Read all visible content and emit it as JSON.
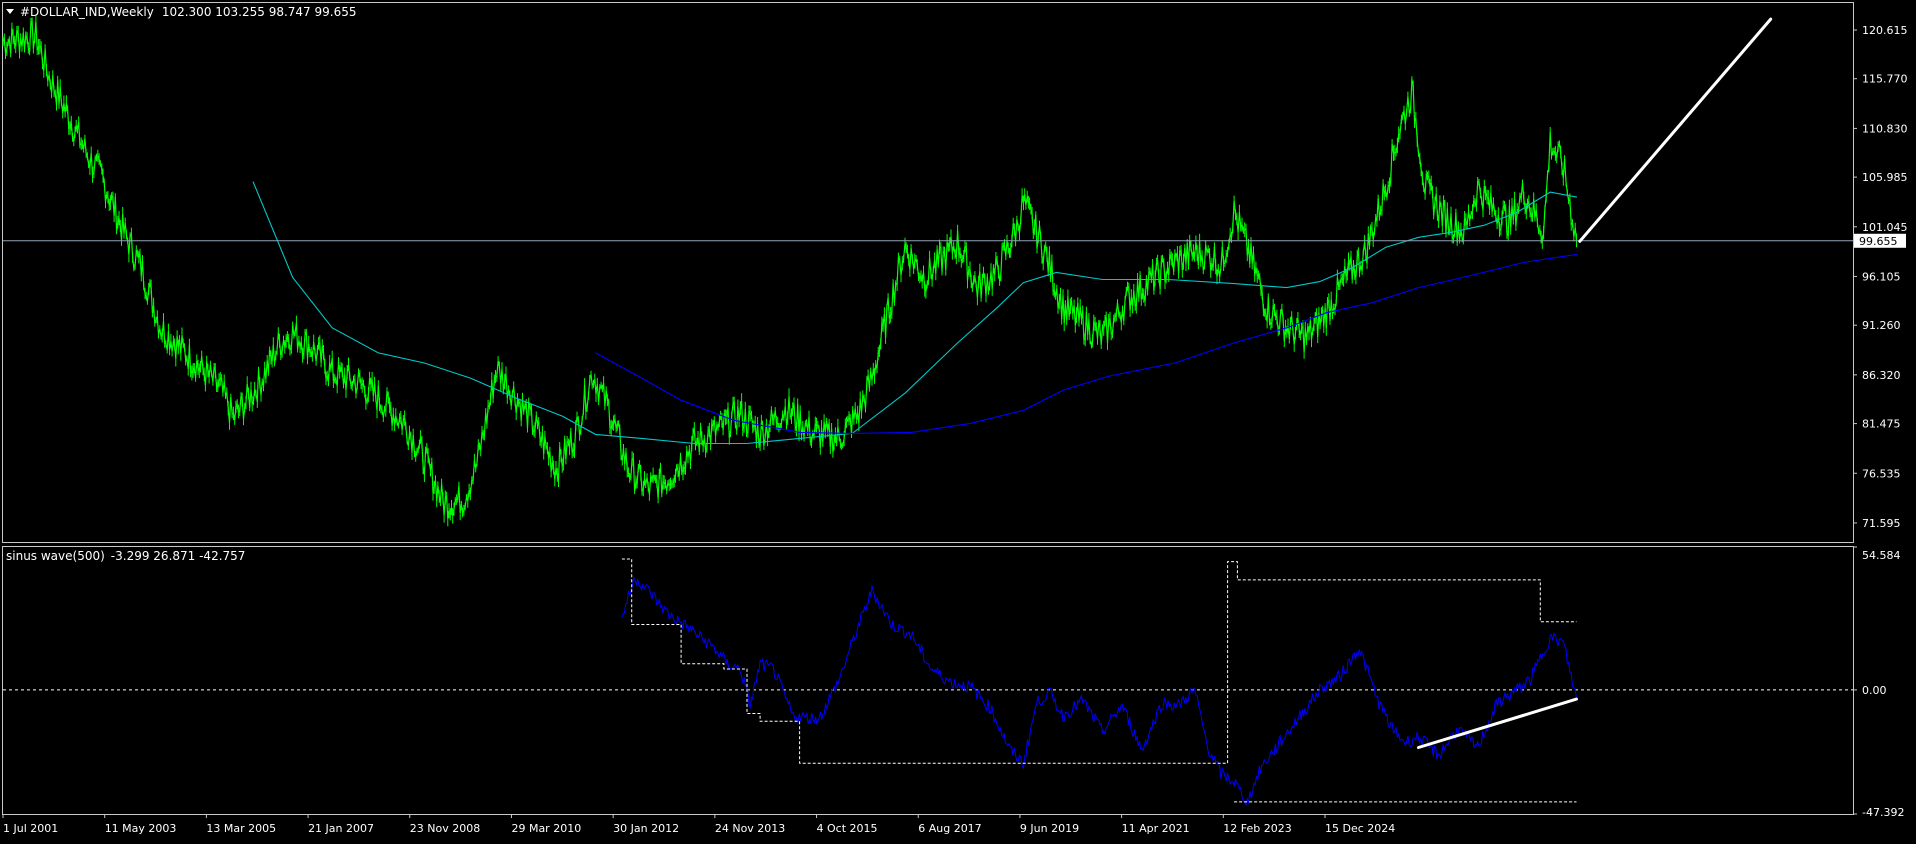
{
  "main_panel": {
    "header": {
      "symbol": "#DOLLAR_IND,Weekly",
      "ohlc": "102.300 103.255 98.747 99.655"
    },
    "y_ticks": [
      "120.615",
      "115.770",
      "110.830",
      "105.985",
      "101.045",
      "96.105",
      "91.260",
      "86.320",
      "81.475",
      "76.535",
      "71.595"
    ],
    "current_price_label": "99.655"
  },
  "sub_panel": {
    "header": {
      "indicator": "sinus wave(500)",
      "values": "-3.299 26.871 -42.757"
    },
    "y_ticks": [
      "54.584",
      "0.00",
      "-47.392"
    ]
  },
  "x_ticks": [
    "1 Jul 2001",
    "11 May 2003",
    "13 Mar 2005",
    "21 Jan 2007",
    "23 Nov 2008",
    "29 Mar 2010",
    "30 Jan 2012",
    "24 Nov 2013",
    "4 Oct 2015",
    "6 Aug 2017",
    "9 Jun 2019",
    "11 Apr 2021",
    "12 Feb 2023",
    "15 Dec 2024"
  ],
  "colors": {
    "background": "#000000",
    "frame": "#c8c8c8",
    "text": "#ffffff",
    "price_line": "#00ff00",
    "ma_fast": "#00c8c8",
    "ma_slow": "#0000ff",
    "hline": "#8fa3b8",
    "indicator_line": "#0000ff",
    "indicator_band": "#ffffff",
    "trendline": "#ffffff"
  },
  "chart_data": [
    {
      "type": "line",
      "title": "#DOLLAR_IND,Weekly",
      "ylim": [
        69.7,
        123.3
      ],
      "xlim": [
        2001.5,
        2029.6
      ],
      "series": [
        {
          "role": "price",
          "x": [
            2001.5,
            2002.0,
            2002.2,
            2002.5,
            2002.8,
            2003.0,
            2003.3,
            2003.6,
            2003.9,
            2004.2,
            2004.5,
            2004.8,
            2005.0,
            2005.4,
            2005.7,
            2005.9,
            2006.2,
            2006.5,
            2006.9,
            2007.2,
            2007.6,
            2007.9,
            2008.2,
            2008.5,
            2008.7,
            2009.0,
            2009.2,
            2009.6,
            2009.9,
            2010.2,
            2010.45,
            2010.7,
            2011.0,
            2011.3,
            2011.6,
            2012.0,
            2012.4,
            2012.7,
            2013.0,
            2013.4,
            2013.8,
            2014.2,
            2014.5,
            2014.7,
            2015.0,
            2015.2,
            2015.5,
            2015.8,
            2016.0,
            2016.3,
            2016.6,
            2016.9,
            2017.0,
            2017.3,
            2017.6,
            2017.9,
            2018.2,
            2018.6,
            2019.0,
            2019.3,
            2019.6,
            2019.9,
            2020.0,
            2020.2,
            2020.4,
            2020.7,
            2021.0,
            2021.3,
            2021.6,
            2021.9,
            2022.2,
            2022.5,
            2022.7,
            2022.9,
            2023.1,
            2023.4,
            2023.7,
            2023.9,
            2024.1,
            2024.4,
            2024.6,
            2024.9,
            2025.0,
            2025.2,
            2025.4
          ],
          "values": [
            119.5,
            120.0,
            116.0,
            112.0,
            108.0,
            106.0,
            101.0,
            97.0,
            91.0,
            89.0,
            87.0,
            85.0,
            82.0,
            85.5,
            89.5,
            90.5,
            89.0,
            86.5,
            85.5,
            84.0,
            81.5,
            78.0,
            73.5,
            74.0,
            77.5,
            87.0,
            85.0,
            81.0,
            77.0,
            80.5,
            86.5,
            83.0,
            77.0,
            75.0,
            76.0,
            79.5,
            81.0,
            82.5,
            80.5,
            83.0,
            80.5,
            80.0,
            82.5,
            86.0,
            94.0,
            99.0,
            96.0,
            98.0,
            99.5,
            95.0,
            96.5,
            101.0,
            103.5,
            99.0,
            93.0,
            91.5,
            90.0,
            94.0,
            96.0,
            97.5,
            98.5,
            98.0,
            97.0,
            102.5,
            99.0,
            93.0,
            91.0,
            90.0,
            92.5,
            96.0,
            98.5,
            105.0,
            110.5,
            114.5,
            105.0,
            102.0,
            100.5,
            105.0,
            103.0,
            101.5,
            104.5,
            100.5,
            109.5,
            107.0,
            99.7
          ]
        },
        {
          "role": "ma-fast",
          "x": [
            2005.3,
            2005.9,
            2006.5,
            2007.2,
            2007.9,
            2008.6,
            2009.3,
            2010.0,
            2010.5,
            2011.2,
            2012.0,
            2012.8,
            2013.6,
            2014.4,
            2015.2,
            2016.0,
            2016.6,
            2017.0,
            2017.5,
            2018.2,
            2019.2,
            2020.2,
            2021.0,
            2021.5,
            2022.0,
            2022.5,
            2023.0,
            2023.5,
            2024.0,
            2024.5,
            2025.0,
            2025.4
          ],
          "values": [
            105.5,
            96.0,
            91.0,
            88.5,
            87.5,
            86.0,
            84.0,
            82.2,
            80.4,
            80.0,
            79.5,
            79.5,
            80.0,
            80.5,
            84.5,
            89.5,
            93.0,
            95.5,
            96.5,
            95.8,
            95.8,
            95.4,
            95.0,
            95.6,
            97.0,
            99.0,
            100.0,
            100.5,
            101.2,
            102.5,
            104.5,
            104.0
          ]
        },
        {
          "role": "ma-slow",
          "x": [
            2010.5,
            2011.2,
            2011.8,
            2012.6,
            2013.6,
            2014.4,
            2015.3,
            2016.2,
            2017.0,
            2017.6,
            2018.3,
            2019.3,
            2020.2,
            2021.0,
            2021.6,
            2022.3,
            2023.0,
            2023.8,
            2024.6,
            2025.4
          ],
          "values": [
            88.5,
            86.0,
            83.8,
            81.8,
            80.6,
            80.5,
            80.6,
            81.5,
            82.8,
            84.8,
            86.2,
            87.5,
            89.5,
            91.0,
            92.5,
            93.5,
            95.0,
            96.2,
            97.5,
            98.3
          ]
        },
        {
          "role": "current-price",
          "x": [
            2001.5,
            2026.8
          ],
          "values": [
            99.655,
            99.655
          ]
        },
        {
          "role": "trendline",
          "x": [
            2025.45,
            2028.35
          ],
          "values": [
            99.6,
            121.7
          ]
        }
      ]
    },
    {
      "type": "line",
      "title": "sinus wave(500)",
      "ylim": [
        -47.392,
        54.584
      ],
      "xlim": [
        2001.5,
        2029.6
      ],
      "series": [
        {
          "role": "indicator",
          "x": [
            2010.9,
            2011.1,
            2011.3,
            2011.6,
            2011.9,
            2012.3,
            2012.5,
            2012.7,
            2012.85,
            2013.0,
            2013.2,
            2013.5,
            2013.9,
            2014.2,
            2014.4,
            2014.7,
            2015.0,
            2015.3,
            2015.6,
            2015.9,
            2016.2,
            2016.5,
            2016.8,
            2017.0,
            2017.2,
            2017.4,
            2017.6,
            2017.9,
            2018.2,
            2018.5,
            2018.8,
            2019.1,
            2019.35,
            2019.6,
            2019.8,
            2020.0,
            2020.2,
            2020.4,
            2020.6,
            2020.9,
            2021.2,
            2021.5,
            2021.8,
            2022.1,
            2022.4,
            2022.6,
            2022.8,
            2023.0,
            2023.3,
            2023.6,
            2023.9,
            2024.2,
            2024.5,
            2024.7,
            2025.0,
            2025.2,
            2025.4
          ],
          "values": [
            28,
            43,
            38,
            29,
            24,
            16,
            10,
            8,
            -6,
            10,
            8,
            -10,
            -11,
            4,
            18,
            38,
            25,
            21,
            8,
            3,
            1,
            -7,
            -23,
            -28,
            -5,
            -1,
            -10,
            -4,
            -16,
            -6,
            -23,
            -5,
            -6,
            0,
            -22,
            -32,
            -35,
            -43,
            -30,
            -20,
            -10,
            0,
            5,
            16,
            -5,
            -15,
            -20,
            -18,
            -25,
            -15,
            -22,
            -5,
            0,
            4,
            20,
            18,
            -3.3
          ]
        },
        {
          "role": "band-upper",
          "x": [
            2010.9,
            2011.05,
            2011.05,
            2011.8,
            2011.8,
            2012.45,
            2012.45,
            2012.8,
            2012.8,
            2013.0,
            2013.0,
            2013.6,
            2013.6,
            2017.5,
            2017.5,
            2020.1,
            2020.1,
            2020.25,
            2020.25,
            2024.85,
            2024.85,
            2025.4
          ],
          "values": [
            50,
            50,
            25,
            25,
            10,
            10,
            8,
            8,
            -9,
            -9,
            -12,
            -12,
            -28,
            -28,
            -28,
            -28,
            49,
            49,
            42,
            42,
            26,
            26
          ]
        },
        {
          "role": "band-lower",
          "x": [
            2020.2,
            2025.4
          ],
          "values": [
            -42.757,
            -42.757
          ]
        },
        {
          "role": "trendline",
          "x": [
            2023.0,
            2025.4
          ],
          "values": [
            -22,
            -3.5
          ]
        }
      ]
    }
  ]
}
